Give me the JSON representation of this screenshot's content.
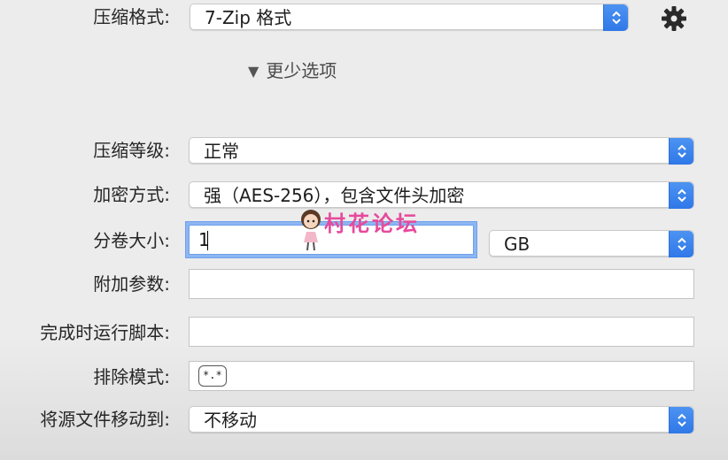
{
  "format": {
    "label": "压缩格式:",
    "value": "7-Zip 格式"
  },
  "settings_icon": "gear-icon",
  "disclosure": {
    "label": "更少选项"
  },
  "level": {
    "label": "压缩等级:",
    "value": "正常"
  },
  "encryption": {
    "label": "加密方式:",
    "value": "强（AES-256），包含文件头加密"
  },
  "split": {
    "label": "分卷大小:",
    "value": "1",
    "unit": "GB"
  },
  "extra_params": {
    "label": "附加参数:",
    "value": ""
  },
  "post_script": {
    "label": "完成时运行脚本:",
    "value": ""
  },
  "exclude": {
    "label": "排除模式:",
    "token": "*.*"
  },
  "move_to": {
    "label": "将源文件移动到:",
    "value": "不移动"
  },
  "watermark": {
    "text": "村花论坛"
  },
  "colors": {
    "accent": "#3a82f0",
    "watermark": "#e64a9c"
  }
}
